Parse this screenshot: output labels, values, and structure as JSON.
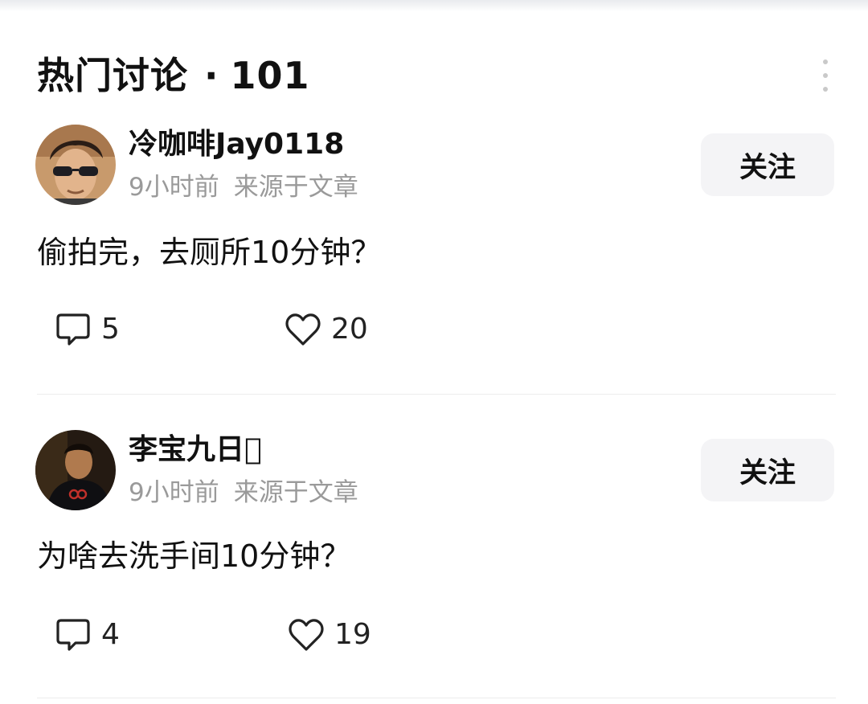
{
  "header": {
    "title": "热门讨论",
    "separator": "·",
    "count": "101"
  },
  "comments": [
    {
      "username": "冷咖啡Jay0118",
      "time": "9小时前",
      "source": "来源于文章",
      "follow_label": "关注",
      "text": "偷拍完，去厕所10分钟？",
      "reply_count": "5",
      "like_count": "20",
      "avatar_icon": "avatar-sunglasses-man"
    },
    {
      "username": "李宝九日\u0000",
      "time": "9小时前",
      "source": "来源于文章",
      "follow_label": "关注",
      "text": "为啥去洗手间10分钟？",
      "reply_count": "4",
      "like_count": "19",
      "avatar_icon": "avatar-dark-portrait"
    }
  ],
  "icons": {
    "more": "more-vertical-icon",
    "reply": "comment-bubble-icon",
    "like": "heart-outline-icon"
  },
  "colors": {
    "text_primary": "#111111",
    "text_secondary": "#9a9a9a",
    "button_bg": "#f4f4f6",
    "divider": "#ededed"
  }
}
